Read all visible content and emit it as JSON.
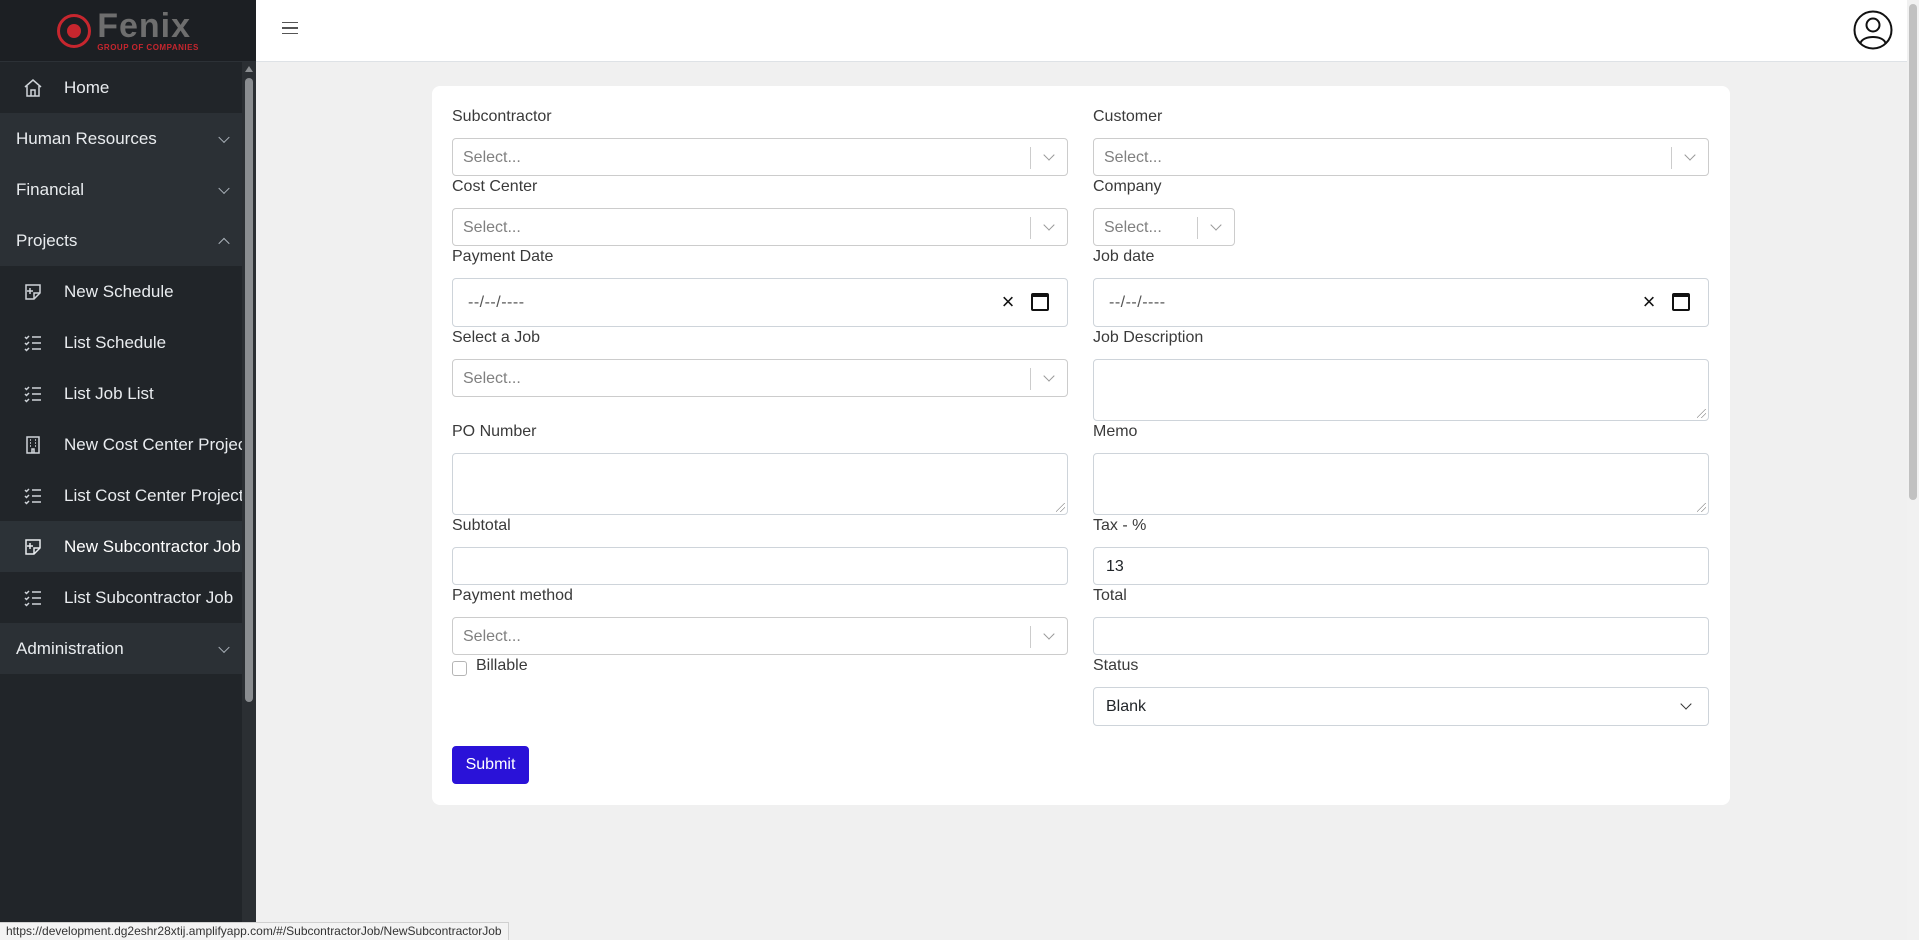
{
  "brand": {
    "name": "Fenix",
    "tagline": "GROUP OF COMPANIES",
    "color": "#c7262e"
  },
  "sidebar": {
    "items": [
      {
        "label": "Home",
        "icon": "home-icon",
        "kind": "top"
      },
      {
        "label": "Human Resources",
        "kind": "group",
        "expanded": false
      },
      {
        "label": "Financial",
        "kind": "group",
        "expanded": false
      },
      {
        "label": "Projects",
        "kind": "group",
        "expanded": true
      },
      {
        "label": "New Schedule",
        "icon": "new-document-icon",
        "kind": "sub"
      },
      {
        "label": "List Schedule",
        "icon": "list-icon",
        "kind": "sub"
      },
      {
        "label": "List Job List",
        "icon": "list-icon",
        "kind": "sub"
      },
      {
        "label": "New Cost Center Project",
        "icon": "building-icon",
        "kind": "sub"
      },
      {
        "label": "List Cost Center Project",
        "icon": "list-icon",
        "kind": "sub"
      },
      {
        "label": "New Subcontractor Job",
        "icon": "new-document-icon",
        "kind": "sub",
        "active": true
      },
      {
        "label": "List Subcontractor Job",
        "icon": "list-icon",
        "kind": "sub"
      },
      {
        "label": "Administration",
        "kind": "group",
        "expanded": false
      }
    ]
  },
  "header": {
    "menu_icon": "hamburger-icon",
    "user_icon": "user-avatar-icon"
  },
  "form": {
    "subcontractor": {
      "label": "Subcontractor",
      "placeholder": "Select..."
    },
    "customer": {
      "label": "Customer",
      "placeholder": "Select..."
    },
    "cost_center": {
      "label": "Cost Center",
      "placeholder": "Select..."
    },
    "company": {
      "label": "Company",
      "placeholder": "Select..."
    },
    "payment_date": {
      "label": "Payment Date",
      "value": "--/--/----"
    },
    "job_date": {
      "label": "Job date",
      "value": "--/--/----"
    },
    "select_job": {
      "label": "Select a Job",
      "placeholder": "Select..."
    },
    "job_description": {
      "label": "Job Description",
      "value": ""
    },
    "po_number": {
      "label": "PO Number",
      "value": ""
    },
    "memo": {
      "label": "Memo",
      "value": ""
    },
    "subtotal": {
      "label": "Subtotal",
      "value": ""
    },
    "tax": {
      "label": "Tax - %",
      "value": "13"
    },
    "payment_method": {
      "label": "Payment method",
      "placeholder": "Select..."
    },
    "total": {
      "label": "Total",
      "value": ""
    },
    "billable": {
      "label": "Billable",
      "checked": false
    },
    "status": {
      "label": "Status",
      "value": "Blank"
    },
    "submit_label": "Submit"
  },
  "colors": {
    "sidebar_bg": "#212529",
    "primary": "#2a12d8",
    "page_bg": "#f0f0f0"
  },
  "status_url": "https://development.dg2eshr28xtij.amplifyapp.com/#/SubcontractorJob/NewSubcontractorJob"
}
